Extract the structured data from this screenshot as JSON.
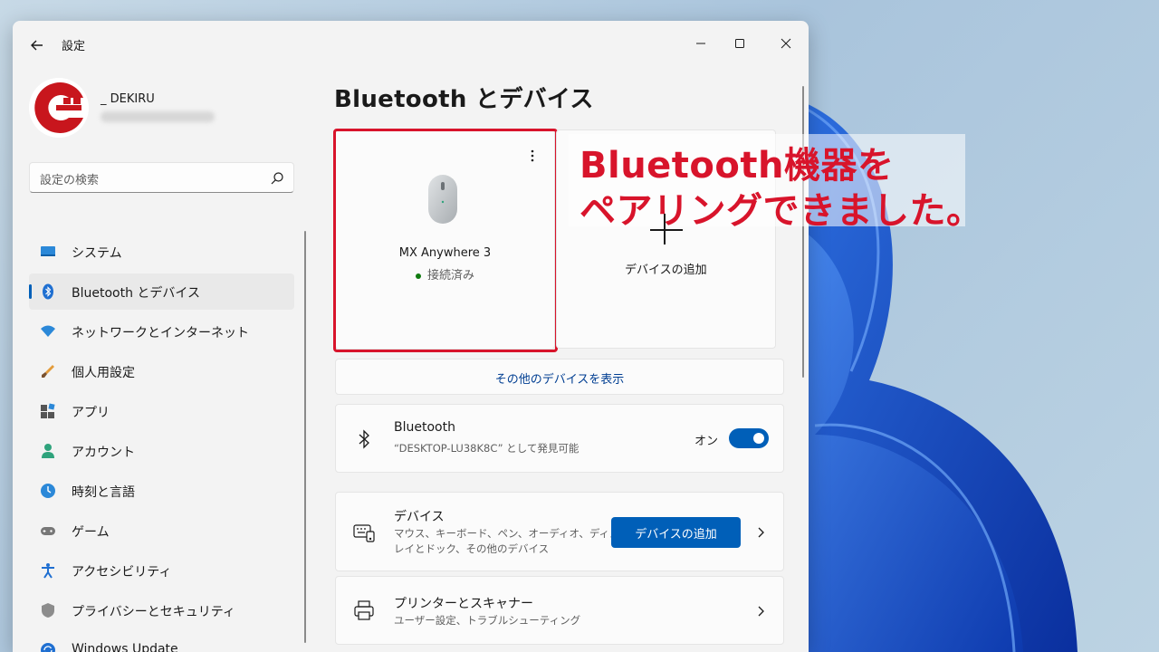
{
  "window": {
    "title": "設定",
    "back_icon": "back-arrow-icon",
    "controls": [
      "minimize-icon",
      "maximize-icon",
      "close-icon"
    ]
  },
  "profile": {
    "name": "_ DEKIRU"
  },
  "search": {
    "placeholder": "設定の検索",
    "icon": "search-icon"
  },
  "sidebar": {
    "items": [
      {
        "label": "システム",
        "icon": "system-icon",
        "active": false
      },
      {
        "label": "Bluetooth とデバイス",
        "icon": "bluetooth-icon",
        "active": true
      },
      {
        "label": "ネットワークとインターネット",
        "icon": "wifi-icon",
        "active": false
      },
      {
        "label": "個人用設定",
        "icon": "brush-icon",
        "active": false
      },
      {
        "label": "アプリ",
        "icon": "apps-icon",
        "active": false
      },
      {
        "label": "アカウント",
        "icon": "account-icon",
        "active": false
      },
      {
        "label": "時刻と言語",
        "icon": "time-language-icon",
        "active": false
      },
      {
        "label": "ゲーム",
        "icon": "gamepad-icon",
        "active": false
      },
      {
        "label": "アクセシビリティ",
        "icon": "accessibility-icon",
        "active": false
      },
      {
        "label": "プライバシーとセキュリティ",
        "icon": "shield-icon",
        "active": false
      },
      {
        "label": "Windows Update",
        "icon": "update-icon",
        "active": false
      }
    ]
  },
  "main": {
    "title": "Bluetooth とデバイス",
    "device_tile": {
      "name": "MX Anywhere 3",
      "status": "接続済み",
      "icon": "mouse-icon"
    },
    "add_tile": {
      "label": "デバイスの追加"
    },
    "show_more": "その他のデバイスを表示",
    "bluetooth_card": {
      "title": "Bluetooth",
      "subtitle": "“DESKTOP-LU38K8C” として発見可能",
      "toggle_label": "オン",
      "toggle_on": true
    },
    "devices_card": {
      "title": "デバイス",
      "subtitle_line1": "マウス、キーボード、ペン、オーディオ、ディスプ",
      "subtitle_line2": "レイとドック、その他のデバイス",
      "button": "デバイスの追加"
    },
    "printers_card": {
      "title": "プリンターとスキャナー",
      "subtitle": "ユーザー設定、トラブルシューティング"
    }
  },
  "annotation": {
    "line1": "Bluetooth機器を",
    "line2": "ペアリングできました。"
  },
  "colors": {
    "accent": "#005fb8",
    "highlight": "#d8142b",
    "connected": "#0f7b0f"
  }
}
